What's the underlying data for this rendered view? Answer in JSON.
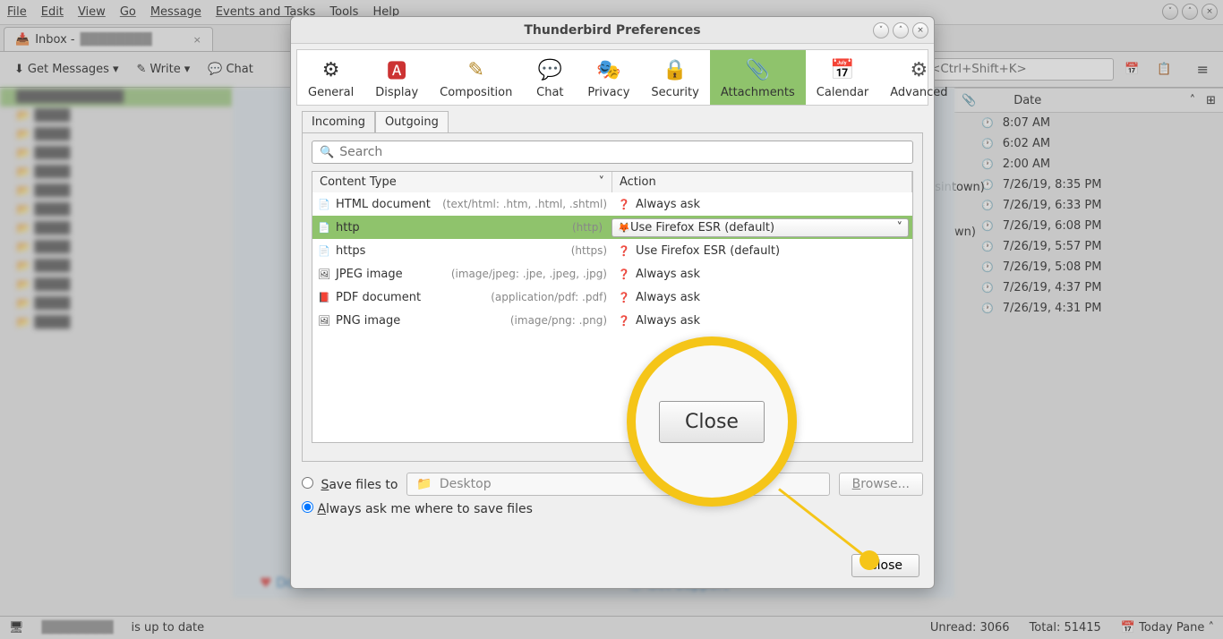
{
  "menu": {
    "file": "File",
    "edit": "Edit",
    "view": "View",
    "go": "Go",
    "message": "Message",
    "events": "Events and Tasks",
    "tools": "Tools",
    "help": "Help"
  },
  "tab": {
    "label": "Inbox - "
  },
  "toolbar": {
    "get": "Get Messages",
    "write": "Write",
    "chat": "Chat",
    "search_placeholder": "ages <Ctrl+Shift+K>"
  },
  "dialog": {
    "title": "Thunderbird Preferences",
    "cats": [
      "General",
      "Display",
      "Composition",
      "Chat",
      "Privacy",
      "Security",
      "Attachments",
      "Calendar",
      "Advanced"
    ],
    "subtabs": {
      "incoming": "Incoming",
      "outgoing": "Outgoing"
    },
    "search_placeholder": "Search",
    "th": {
      "content": "Content Type",
      "action": "Action"
    },
    "rows": [
      {
        "name": "HTML document",
        "ext": "(text/html: .htm, .html, .shtml)",
        "action": "Always ask",
        "ico": "📄"
      },
      {
        "name": "http",
        "ext": "(http)",
        "action": "Use Firefox ESR (default)",
        "ico": "📄",
        "sel": true,
        "dropdown": true
      },
      {
        "name": "https",
        "ext": "(https)",
        "action": "Use Firefox ESR (default)",
        "ico": "📄"
      },
      {
        "name": "JPEG image",
        "ext": "(image/jpeg: .jpe, .jpeg, .jpg)",
        "action": "Always ask",
        "ico": "🖼"
      },
      {
        "name": "PDF document",
        "ext": "(application/pdf: .pdf)",
        "action": "Always ask",
        "ico": "📕"
      },
      {
        "name": "PNG image",
        "ext": "(image/png: .png)",
        "action": "Always ask",
        "ico": "🖼"
      }
    ],
    "save_files": "Save files to",
    "desktop": "Desktop",
    "browse": "Browse...",
    "always_ask": "Always ask me where to save files",
    "close": "Close"
  },
  "dates": {
    "header": "Date",
    "items": [
      "8:07 AM",
      "6:02 AM",
      "2:00 AM",
      "7/26/19, 8:35 PM",
      "7/26/19, 6:33 PM",
      "7/26/19, 6:08 PM",
      "7/26/19, 5:57 PM",
      "7/26/19, 5:08 PM",
      "7/26/19, 4:37 PM",
      "7/26/19, 4:31 PM"
    ]
  },
  "snippets": {
    "bandsintown": "dsintown)",
    "wn": "wn)"
  },
  "status": {
    "uptodate": "is up to date",
    "unread_label": "Unread:",
    "unread": "3066",
    "total_label": "Total:",
    "total": "51415",
    "today": "Today Pane"
  },
  "links": {
    "donate": "Donate",
    "support": "Get Support"
  },
  "callout": {
    "close": "Close"
  }
}
